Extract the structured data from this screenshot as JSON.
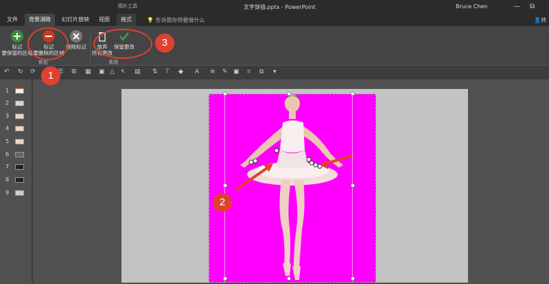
{
  "titlebar": {
    "context_group": "图片工具",
    "doc_title": "文字穿插.pptx - PowerPoint",
    "user": "Bruce Chen",
    "minimize": "—",
    "restore": "⧉"
  },
  "tabs": [
    {
      "label": "文件"
    },
    {
      "label": "背景消除"
    },
    {
      "label": "幻灯片放映"
    },
    {
      "label": "视图"
    },
    {
      "label": "格式"
    }
  ],
  "tellme": {
    "text": "告诉我你想要做什么"
  },
  "share": {
    "label": "共"
  },
  "ribbon": {
    "mark_keep": "标记\n要保留的区域",
    "mark_keep_l1": "标记",
    "mark_keep_l2": "要保留的区域",
    "mark_remove_l1": "标记",
    "mark_remove_l2": "要删除的区域",
    "delete_mark": "删除标记",
    "discard_l1": "放弃",
    "discard_l2": "所有更改",
    "keep_changes": "保留更改",
    "group_optimize": "优化",
    "group_close": "关闭"
  },
  "annotations": {
    "one": "1",
    "two": "2",
    "three": "3"
  },
  "thumbnails": [
    {
      "num": "1"
    },
    {
      "num": "2"
    },
    {
      "num": "3"
    },
    {
      "num": "4"
    },
    {
      "num": "5"
    },
    {
      "num": "6"
    },
    {
      "num": "7"
    },
    {
      "num": "8"
    },
    {
      "num": "9"
    }
  ],
  "colors": {
    "accent_red": "#e04030",
    "removed_background": "#ff00ff"
  }
}
